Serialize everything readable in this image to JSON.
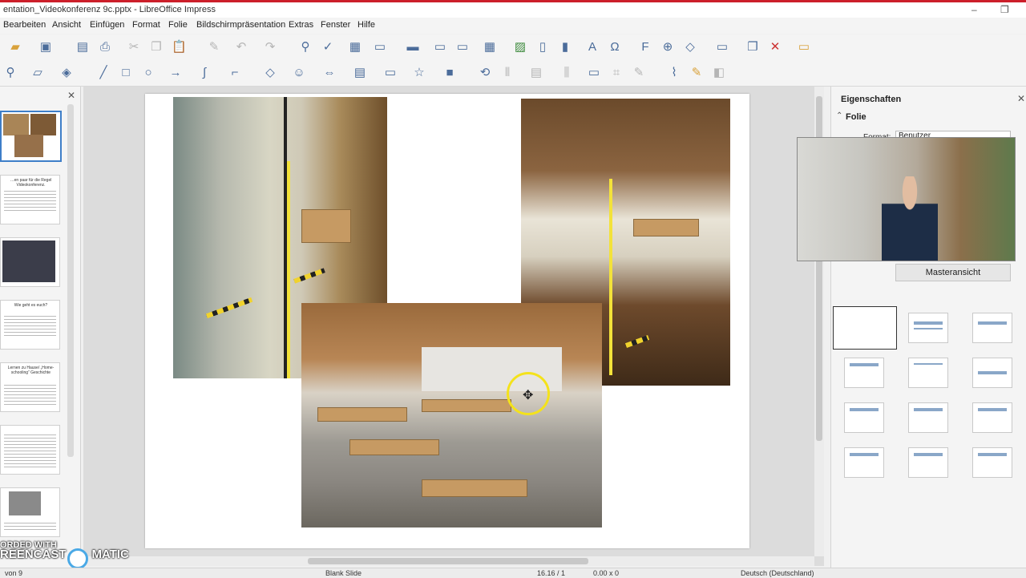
{
  "window": {
    "title": "entation_Videokonferenz 9c.pptx - LibreOffice Impress",
    "minimize": "–",
    "restore": "❐"
  },
  "menu": [
    "Bearbeiten",
    "Ansicht",
    "Einfügen",
    "Format",
    "Folie",
    "Bildschirmpräsentation",
    "Extras",
    "Fenster",
    "Hilfe"
  ],
  "thumbnails": [
    {
      "title": ""
    },
    {
      "title": "…en paar für die Regel Videokonferenz."
    },
    {
      "title": ""
    },
    {
      "title": "Wie geht es euch?"
    },
    {
      "title": "Lernen zu Hause/ „Home-schooling“ Geschichte"
    },
    {
      "title": ""
    },
    {
      "title": ""
    }
  ],
  "sidebar": {
    "title": "Eigenschaften",
    "section": "Folie",
    "format_label": "Format:",
    "format_value": "Benutzer",
    "master_button": "Masteransicht"
  },
  "status": {
    "page": "von 9",
    "layout": "Blank Slide",
    "position": "16.16 / 1",
    "size": "0.00 x 0",
    "language": "Deutsch (Deutschland)"
  },
  "watermark": {
    "line1": "ORDED WITH",
    "line2": "REENCAST",
    "line3": "MATIC"
  },
  "icons": {
    "cursor": "move-cursor-icon"
  }
}
